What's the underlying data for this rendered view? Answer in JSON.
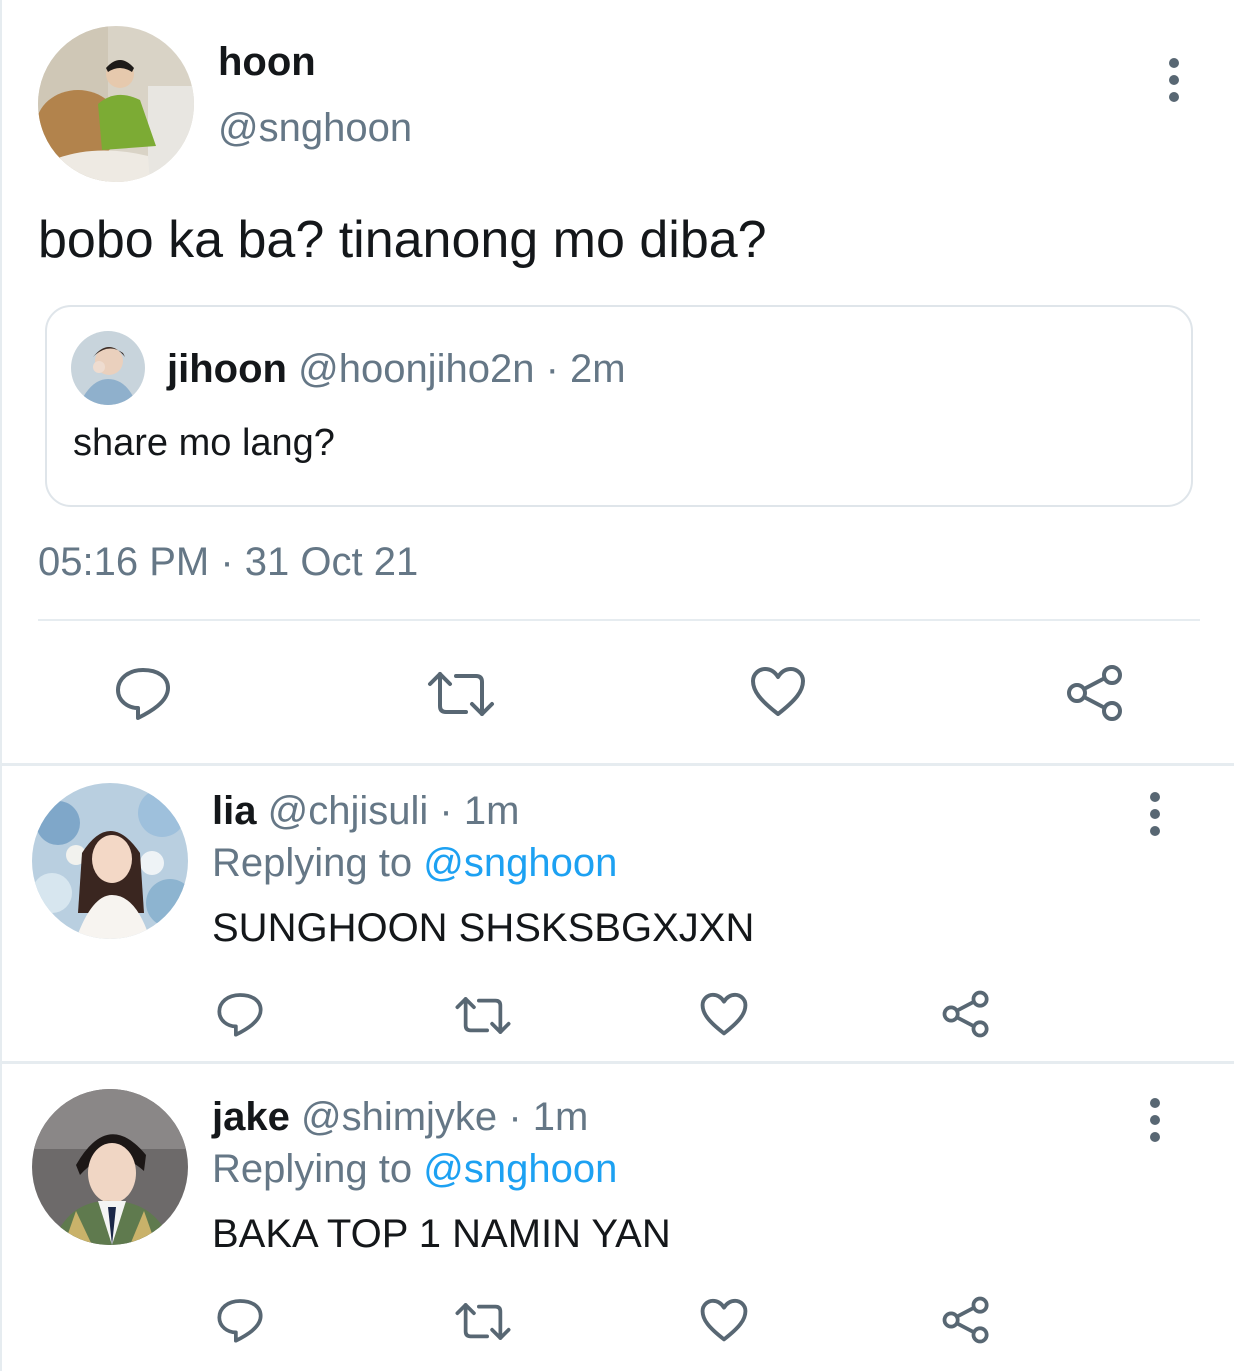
{
  "main_tweet": {
    "name": "hoon",
    "handle": "@snghoon",
    "text": "bobo ka ba? tinanong mo diba?",
    "timestamp": "05:16 PM · 31 Oct 21",
    "quoted": {
      "name": "jihoon",
      "handle": "@hoonjiho2n",
      "separator": "·",
      "age": "2m",
      "text": "share mo lang?"
    }
  },
  "replies": [
    {
      "name": "lia",
      "handle": "@chjisuli",
      "separator": "·",
      "age": "1m",
      "replying_prefix": "Replying to",
      "replying_to": "@snghoon",
      "text": "SUNGHOON SHSKSBGXJXN"
    },
    {
      "name": "jake",
      "handle": "@shimjyke",
      "separator": "·",
      "age": "1m",
      "replying_prefix": "Replying to",
      "replying_to": "@snghoon",
      "text": "BAKA TOP 1 NAMIN YAN"
    }
  ],
  "icons": {
    "reply": "speech-bubble-icon",
    "retweet": "retweet-arrows-icon",
    "like": "heart-icon",
    "share": "share-nodes-icon",
    "more": "vertical-ellipsis-icon"
  },
  "colors": {
    "text": "#14171a",
    "muted": "#657786",
    "link": "#1da1f2",
    "icon": "#586773",
    "divider": "#e6ecf0"
  }
}
